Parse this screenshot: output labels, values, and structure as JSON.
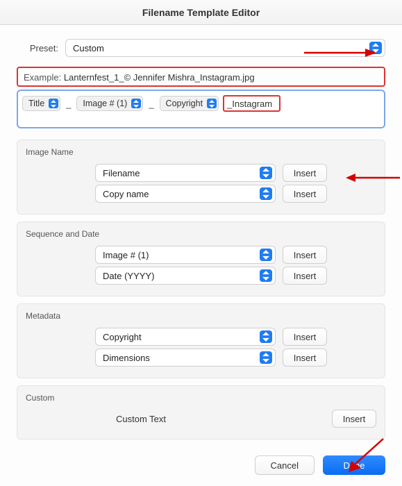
{
  "window": {
    "title": "Filename Template Editor"
  },
  "preset": {
    "label": "Preset:",
    "value": "Custom"
  },
  "example": {
    "label": "Example:",
    "value": "Lanternfest_1_© Jennifer Mishra_Instagram.jpg"
  },
  "tokens": {
    "items": [
      {
        "type": "token",
        "label": "Title"
      },
      {
        "type": "sep",
        "label": "_"
      },
      {
        "type": "token",
        "label": "Image # (1)"
      },
      {
        "type": "sep",
        "label": "_"
      },
      {
        "type": "token",
        "label": "Copyright"
      },
      {
        "type": "text",
        "label": "_Instagram"
      }
    ]
  },
  "sections": {
    "image_name": {
      "title": "Image Name",
      "rows": [
        {
          "select": "Filename",
          "button": "Insert"
        },
        {
          "select": "Copy name",
          "button": "Insert"
        }
      ]
    },
    "sequence_date": {
      "title": "Sequence and Date",
      "rows": [
        {
          "select": "Image # (1)",
          "button": "Insert"
        },
        {
          "select": "Date (YYYY)",
          "button": "Insert"
        }
      ]
    },
    "metadata": {
      "title": "Metadata",
      "rows": [
        {
          "select": "Copyright",
          "button": "Insert"
        },
        {
          "select": "Dimensions",
          "button": "Insert"
        }
      ]
    },
    "custom": {
      "title": "Custom",
      "label": "Custom Text",
      "button": "Insert"
    }
  },
  "footer": {
    "cancel": "Cancel",
    "done": "Done"
  }
}
